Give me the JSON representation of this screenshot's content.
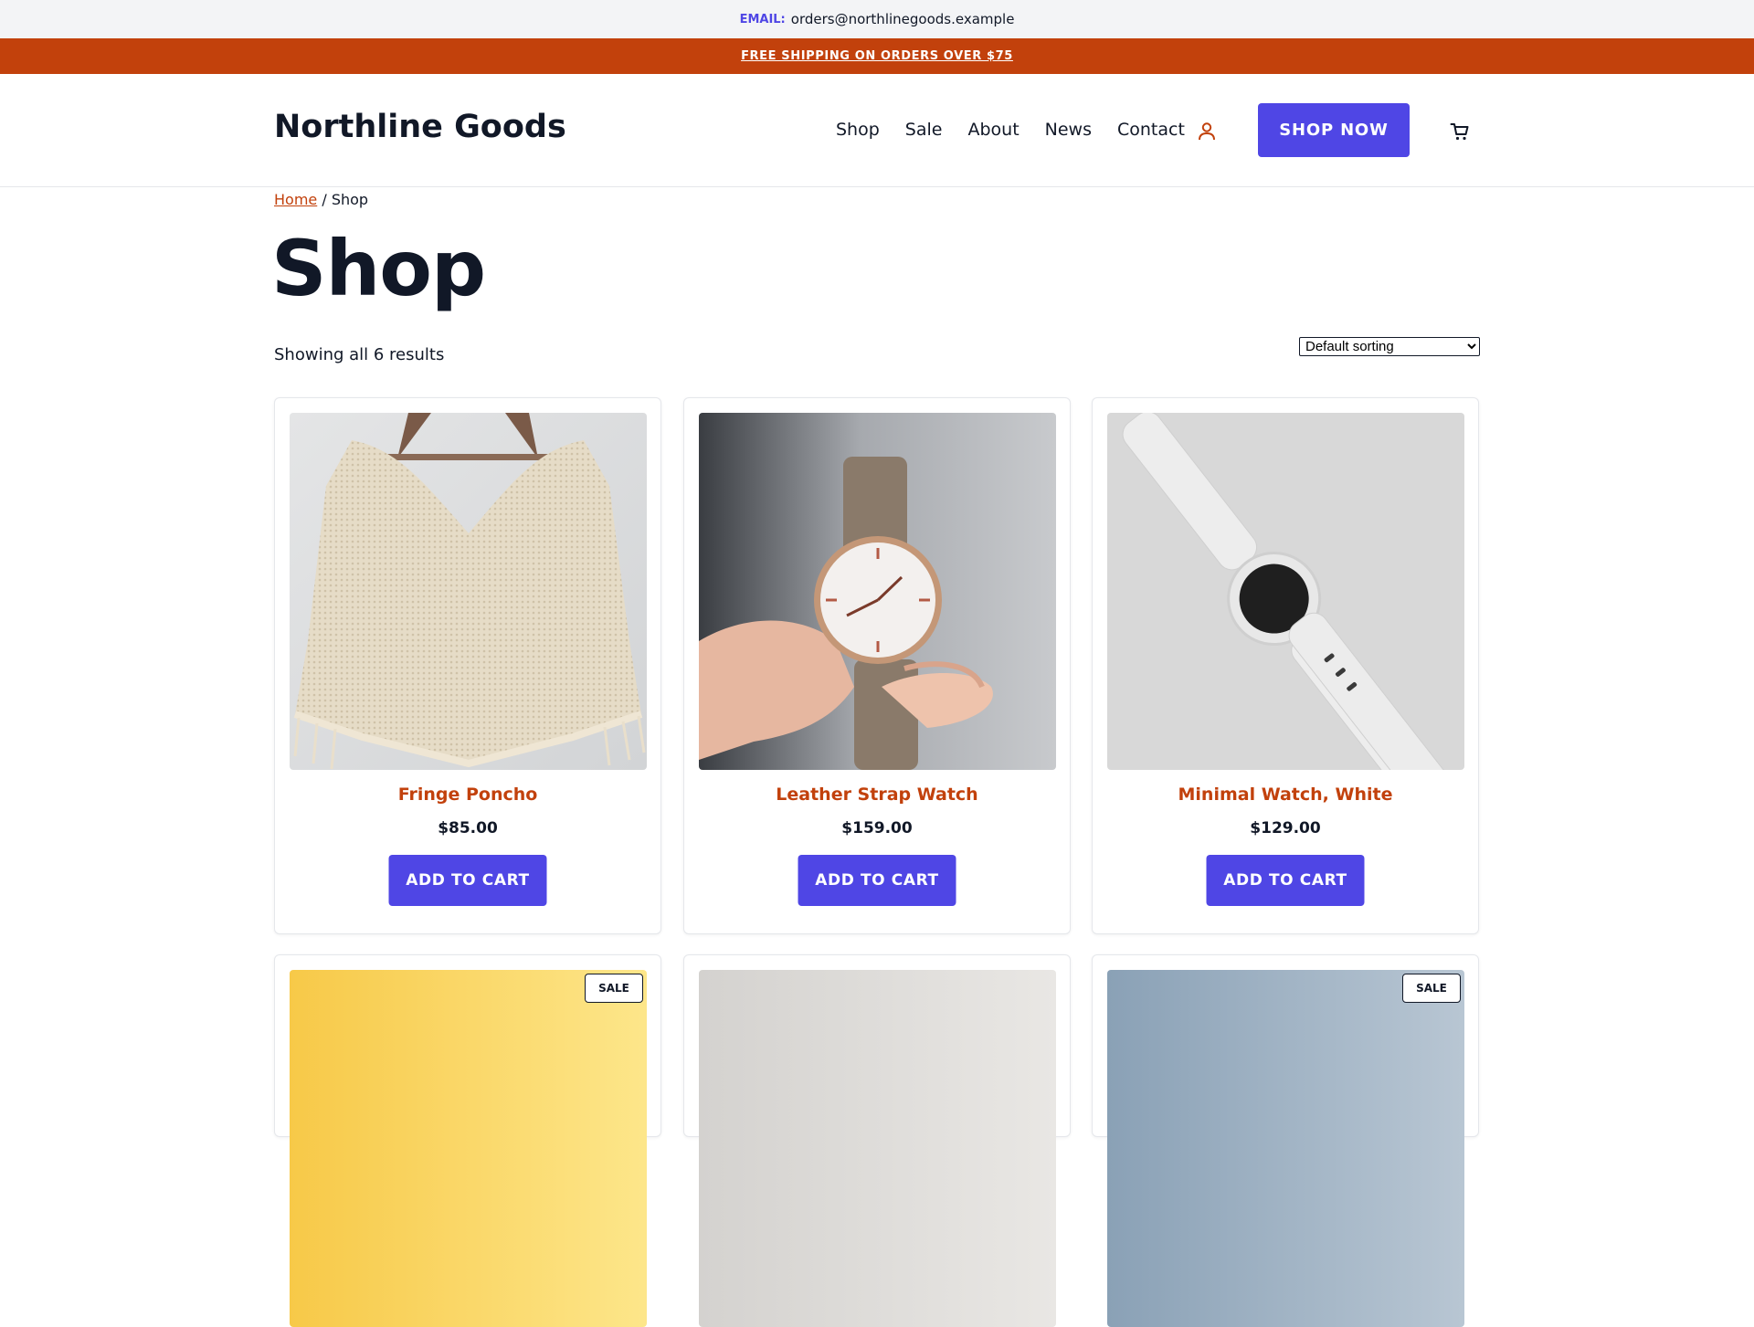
{
  "topbar": {
    "email_label": "EMAIL:",
    "email": "orders@northlinegoods.example"
  },
  "promo": {
    "text": "FREE SHIPPING ON ORDERS OVER $75"
  },
  "header": {
    "brand": "Northline Goods",
    "nav": [
      "Shop",
      "Sale",
      "About",
      "News",
      "Contact"
    ],
    "cta": "SHOP NOW",
    "user_icon": "user-icon",
    "cart_icon": "cart-icon"
  },
  "breadcrumb": {
    "home": "Home",
    "separator": " / ",
    "current": "Shop"
  },
  "page": {
    "title": "Shop",
    "result_count": "Showing all 6 results",
    "sort_selected": "Default sorting"
  },
  "products": [
    {
      "name": "Fringe Poncho",
      "price": "$85.00",
      "button": "ADD TO CART"
    },
    {
      "name": "Leather Strap Watch",
      "price": "$159.00",
      "button": "ADD TO CART"
    },
    {
      "name": "Minimal Watch, White",
      "price": "$129.00",
      "button": "ADD TO CART"
    }
  ],
  "second_row": {
    "badge": "SALE"
  },
  "colors": {
    "accent": "#4f46e5",
    "brand_orange": "#c2410c",
    "topbar_bg": "#f3f4f6",
    "text": "#111827"
  }
}
